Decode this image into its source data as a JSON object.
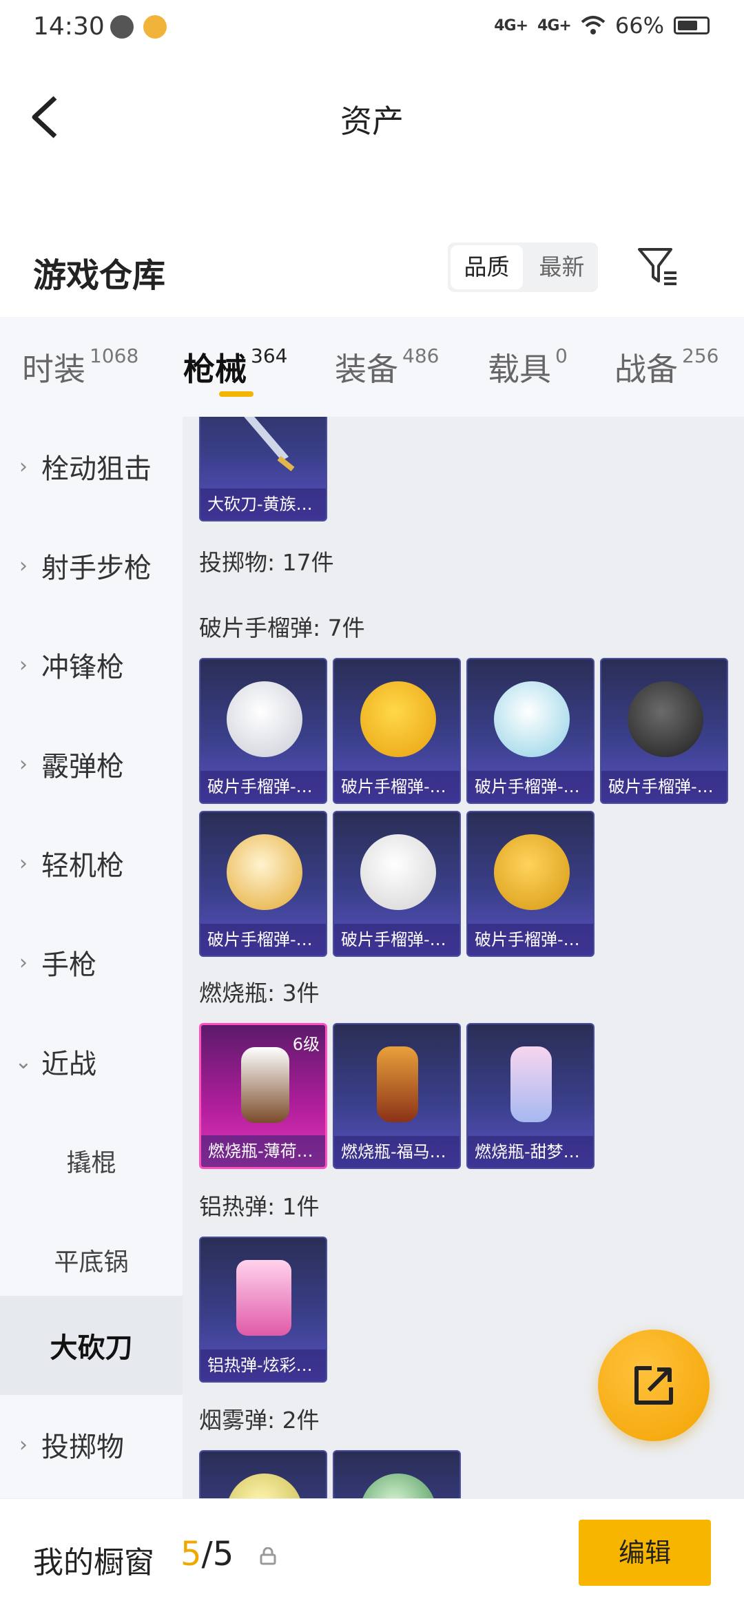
{
  "status_bar": {
    "time": "14:30",
    "net1": "4G+",
    "net2": "4G+",
    "battery": "66%"
  },
  "header": {
    "title": "资产"
  },
  "section": {
    "title": "游戏仓库",
    "sort_options": [
      "品质",
      "最新"
    ]
  },
  "tabs": [
    {
      "label": "时装",
      "count": "1068"
    },
    {
      "label": "枪械",
      "count": "364"
    },
    {
      "label": "装备",
      "count": "486"
    },
    {
      "label": "载具",
      "count": "0"
    },
    {
      "label": "战备",
      "count": "256"
    }
  ],
  "sidebar": {
    "items": [
      "栓动狙击",
      "射手步枪",
      "冲锋枪",
      "霰弹枪",
      "轻机枪",
      "手枪",
      "近战"
    ],
    "sub_items": [
      "撬棍",
      "平底锅",
      "大砍刀"
    ],
    "last_item": "投掷物"
  },
  "content": {
    "top_card_caption": "大砍刀-黄族…",
    "group_throwables": "投掷物: 17件",
    "group_frag": "破片手榴弹: 7件",
    "frag_captions": [
      "破片手榴弹-…",
      "破片手榴弹-…",
      "破片手榴弹-…",
      "破片手榴弹-…",
      "破片手榴弹-…",
      "破片手榴弹-…",
      "破片手榴弹-…"
    ],
    "group_molotov": "燃烧瓶: 3件",
    "molotov_captions": [
      "燃烧瓶-薄荷…",
      "燃烧瓶-福马…",
      "燃烧瓶-甜梦…"
    ],
    "molotov_level": "6级",
    "group_thermite": "铝热弹: 1件",
    "thermite_caption": "铝热弹-炫彩…",
    "group_smoke": "烟雾弹: 2件"
  },
  "bottom": {
    "label": "我的橱窗",
    "current": "5",
    "sep_total": "/5",
    "edit": "编辑"
  }
}
